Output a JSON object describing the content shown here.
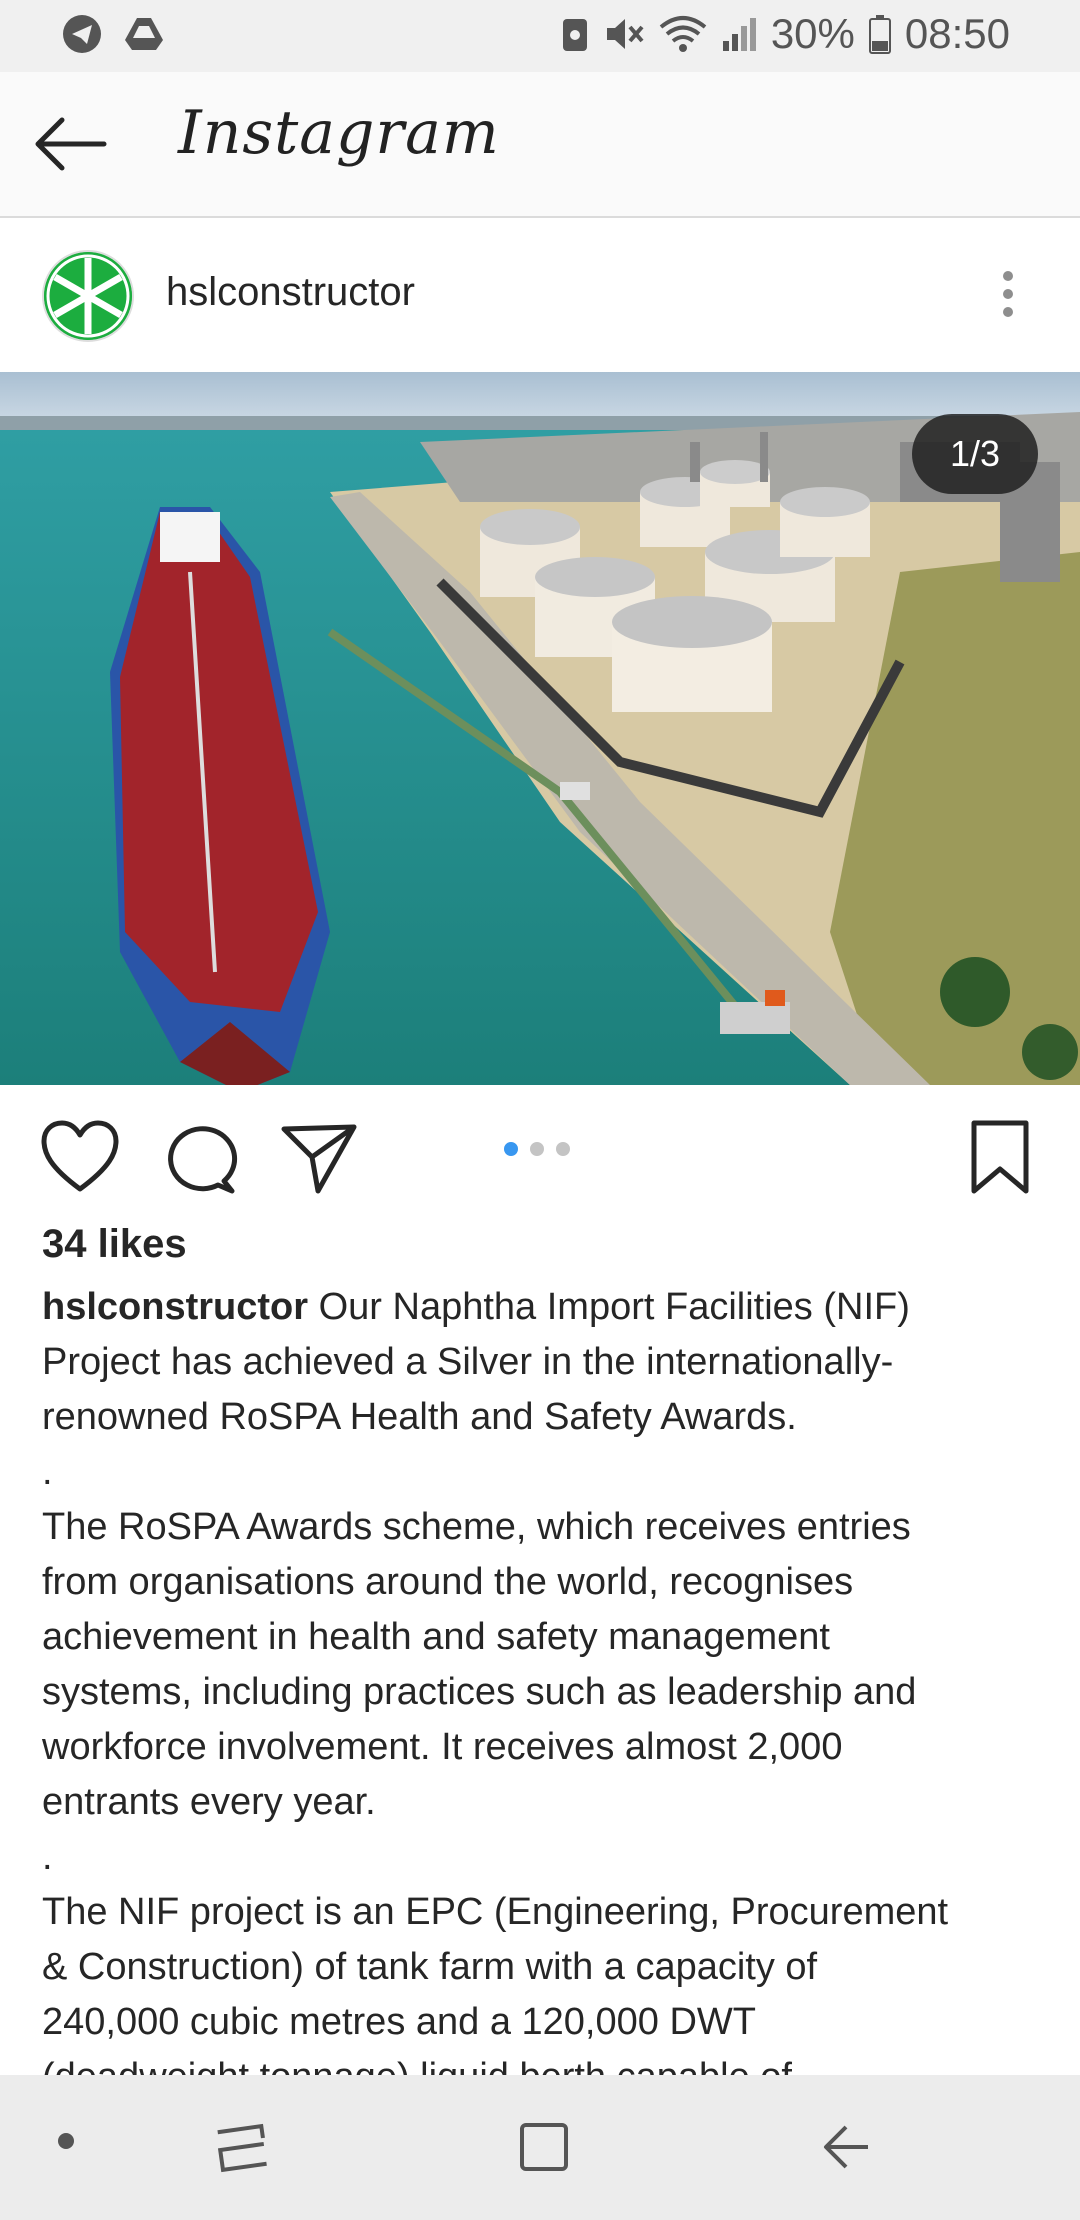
{
  "status_bar": {
    "battery": "30%",
    "time": "08:50",
    "left_icons": [
      "telegram-icon",
      "drive-icon"
    ],
    "right_icons": [
      "notification-icon",
      "mute-icon",
      "wifi-icon",
      "signal-icon",
      "battery-icon"
    ]
  },
  "app_bar": {
    "title": "Instagram"
  },
  "post": {
    "username": "hslconstructor",
    "counter": "1/3",
    "carousel": {
      "current": 1,
      "total": 3
    },
    "likes": "34 likes",
    "caption_lines": [
      "Our Naphtha Import Facilities (NIF)",
      "Project has achieved a Silver in the internationally-",
      "renowned RoSPA Health and Safety Awards.",
      ".",
      "The RoSPA Awards scheme, which receives entries",
      "from organisations around the world, recognises",
      "achievement in health and safety management",
      "systems, including practices such as leadership and",
      "workforce involvement. It receives almost 2,000",
      "entrants every year.",
      ".",
      "The NIF project is an EPC (Engineering, Procurement",
      "& Construction) of tank farm with a capacity of",
      "240,000 cubic metres and a 120,000 DWT",
      "(deadweight tonnage) liquid berth capable of"
    ]
  },
  "colors": {
    "accent": "#3897f0",
    "avatar_green": "#1cad3f"
  }
}
